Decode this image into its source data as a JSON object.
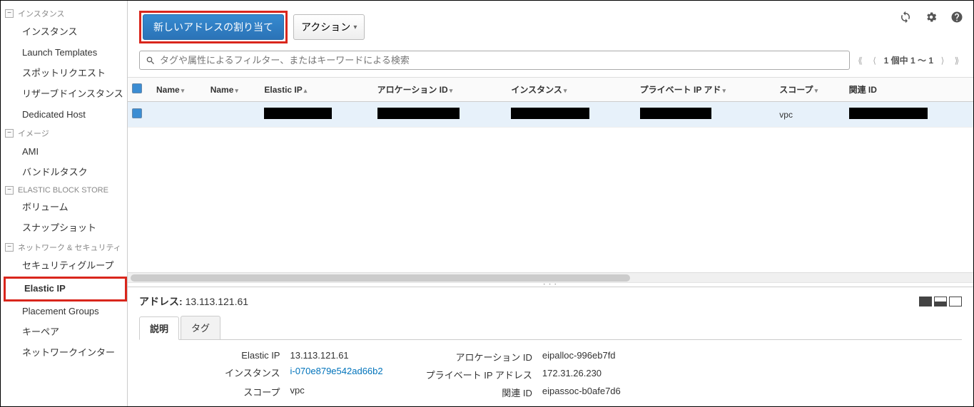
{
  "sidebar": {
    "sections": [
      {
        "label": "インスタンス",
        "items": [
          "インスタンス",
          "Launch Templates",
          "スポットリクエスト",
          "リザーブドインスタンス",
          "Dedicated Host"
        ]
      },
      {
        "label": "イメージ",
        "items": [
          "AMI",
          "バンドルタスク"
        ]
      },
      {
        "label": "ELASTIC BLOCK STORE",
        "items": [
          "ボリューム",
          "スナップショット"
        ]
      },
      {
        "label": "ネットワーク & セキュリティ",
        "items": [
          "セキュリティグループ",
          "Elastic IP",
          "Placement Groups",
          "キーペア",
          "ネットワークインター"
        ]
      }
    ],
    "active": "Elastic IP"
  },
  "toolbar": {
    "primary": "新しいアドレスの割り当て",
    "actions": "アクション"
  },
  "search": {
    "placeholder": "タグや属性によるフィルター、またはキーワードによる検索"
  },
  "pager": {
    "text": "1 個中 1 ～ 1"
  },
  "table": {
    "headers": [
      "Name",
      "Name",
      "Elastic IP",
      "アロケーション ID",
      "インスタンス",
      "プライベート IP アド",
      "スコープ",
      "関連 ID"
    ],
    "row": {
      "scope": "vpc"
    }
  },
  "detail": {
    "title_label": "アドレス:",
    "title_value": "13.113.121.61",
    "tabs": [
      "説明",
      "タグ"
    ],
    "left": {
      "elastic_ip_label": "Elastic IP",
      "elastic_ip_value": "13.113.121.61",
      "instance_label": "インスタンス",
      "instance_value": "i-070e879e542ad66b2",
      "scope_label": "スコープ",
      "scope_value": "vpc"
    },
    "right": {
      "allocation_label": "アロケーション ID",
      "allocation_value": "eipalloc-996eb7fd",
      "private_ip_label": "プライベート IP アドレス",
      "private_ip_value": "172.31.26.230",
      "assoc_label": "関連 ID",
      "assoc_value": "eipassoc-b0afe7d6"
    }
  }
}
